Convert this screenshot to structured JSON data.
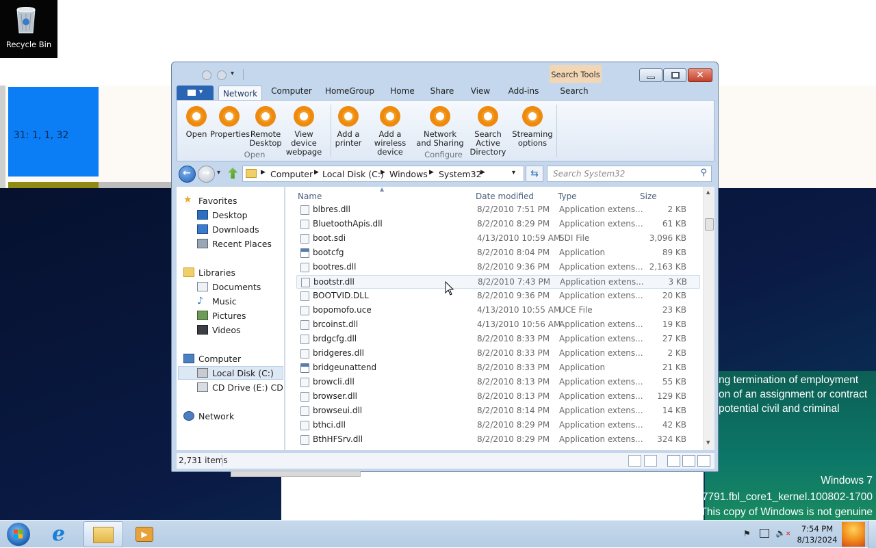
{
  "desktop": {
    "recycle_bin_label": "Recycle Bin",
    "tile_text": "31: 1, 1, 32",
    "notice_lines": [
      "ng termination of employment",
      "on of an assignment or contract",
      "potential civil and criminal"
    ],
    "watermark": {
      "os": "Windows 7",
      "build": "7791.fbl_core1_kernel.100802-1700",
      "genuine": "This copy of Windows is not genuine"
    }
  },
  "window": {
    "contextual_tab_group": "Search Tools",
    "tabs": [
      "Network",
      "Computer",
      "HomeGroup",
      "Home",
      "Share",
      "View",
      "Add-ins",
      "Search"
    ],
    "active_tab": "Network",
    "ribbon": {
      "open_group": {
        "label": "Open",
        "buttons": [
          {
            "label1": "Open",
            "label2": ""
          },
          {
            "label1": "Properties",
            "label2": ""
          },
          {
            "label1": "Remote",
            "label2": "Desktop"
          },
          {
            "label1": "View device",
            "label2": "webpage"
          }
        ]
      },
      "configure_group": {
        "label": "Configure",
        "buttons": [
          {
            "label1": "Add a",
            "label2": "printer"
          },
          {
            "label1": "Add a wireless",
            "label2": "device"
          },
          {
            "label1": "Network",
            "label2": "and Sharing"
          },
          {
            "label1": "Search Active",
            "label2": "Directory"
          },
          {
            "label1": "Streaming",
            "label2": "options"
          }
        ]
      }
    },
    "address": {
      "crumbs": [
        "Computer",
        "Local Disk (C:)",
        "Windows",
        "System32"
      ]
    },
    "search_placeholder": "Search System32",
    "nav_pane": {
      "favorites": "Favorites",
      "favorites_items": [
        "Desktop",
        "Downloads",
        "Recent Places"
      ],
      "libraries": "Libraries",
      "libraries_items": [
        "Documents",
        "Music",
        "Pictures",
        "Videos"
      ],
      "computer": "Computer",
      "computer_items": [
        "Local Disk (C:)",
        "CD Drive (E:) CDROM"
      ],
      "network": "Network"
    },
    "columns": {
      "name": "Name",
      "date": "Date modified",
      "type": "Type",
      "size": "Size"
    },
    "files": [
      {
        "name": "blbres.dll",
        "date": "8/2/2010 7:51 PM",
        "type": "Application extens...",
        "size": "2 KB",
        "icon": "dll"
      },
      {
        "name": "BluetoothApis.dll",
        "date": "8/2/2010 8:29 PM",
        "type": "Application extens...",
        "size": "61 KB",
        "icon": "dll"
      },
      {
        "name": "boot.sdi",
        "date": "4/13/2010 10:59 AM",
        "type": "SDI File",
        "size": "3,096 KB",
        "icon": "file"
      },
      {
        "name": "bootcfg",
        "date": "8/2/2010 8:04 PM",
        "type": "Application",
        "size": "89 KB",
        "icon": "app"
      },
      {
        "name": "bootres.dll",
        "date": "8/2/2010 9:36 PM",
        "type": "Application extens...",
        "size": "2,163 KB",
        "icon": "dll"
      },
      {
        "name": "bootstr.dll",
        "date": "8/2/2010 7:43 PM",
        "type": "Application extens...",
        "size": "3 KB",
        "icon": "dll"
      },
      {
        "name": "BOOTVID.DLL",
        "date": "8/2/2010 9:36 PM",
        "type": "Application extens...",
        "size": "20 KB",
        "icon": "dll"
      },
      {
        "name": "bopomofo.uce",
        "date": "4/13/2010 10:55 AM",
        "type": "UCE File",
        "size": "23 KB",
        "icon": "file"
      },
      {
        "name": "brcoinst.dll",
        "date": "4/13/2010 10:56 AM",
        "type": "Application extens...",
        "size": "19 KB",
        "icon": "dll"
      },
      {
        "name": "brdgcfg.dll",
        "date": "8/2/2010 8:33 PM",
        "type": "Application extens...",
        "size": "27 KB",
        "icon": "dll"
      },
      {
        "name": "bridgeres.dll",
        "date": "8/2/2010 8:33 PM",
        "type": "Application extens...",
        "size": "2 KB",
        "icon": "dll"
      },
      {
        "name": "bridgeunattend",
        "date": "8/2/2010 8:33 PM",
        "type": "Application",
        "size": "21 KB",
        "icon": "app"
      },
      {
        "name": "browcli.dll",
        "date": "8/2/2010 8:13 PM",
        "type": "Application extens...",
        "size": "55 KB",
        "icon": "dll"
      },
      {
        "name": "browser.dll",
        "date": "8/2/2010 8:13 PM",
        "type": "Application extens...",
        "size": "129 KB",
        "icon": "dll"
      },
      {
        "name": "browseui.dll",
        "date": "8/2/2010 8:14 PM",
        "type": "Application extens...",
        "size": "14 KB",
        "icon": "dll"
      },
      {
        "name": "bthci.dll",
        "date": "8/2/2010 8:29 PM",
        "type": "Application extens...",
        "size": "42 KB",
        "icon": "dll"
      },
      {
        "name": "BthHFSrv.dll",
        "date": "8/2/2010 8:29 PM",
        "type": "Application extens...",
        "size": "324 KB",
        "icon": "dll"
      }
    ],
    "highlighted_row": 5,
    "status_count": "2,731 items"
  },
  "taskbar": {
    "time": "7:54 PM",
    "date": "8/13/2024"
  },
  "colors": {
    "ribbon_orange": "#f39c24",
    "tile_blue": "#0b7df5",
    "file_tab_blue": "#2a65b3"
  }
}
